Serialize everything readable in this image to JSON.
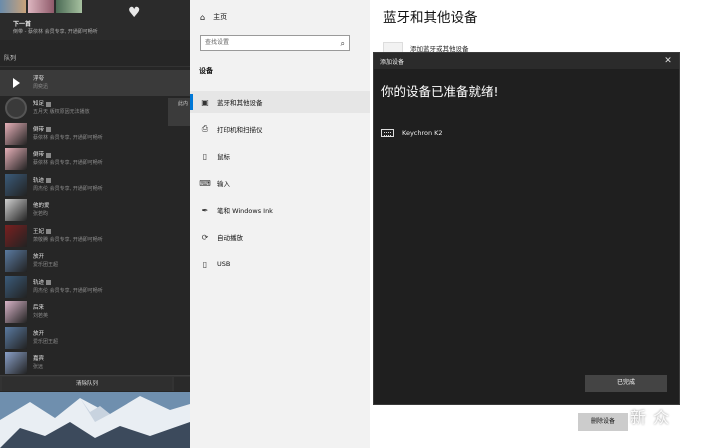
{
  "player": {
    "next_label": "下一首",
    "next_sub": "倒带 - 蔡依林  会员专享, 开通即可畅听",
    "queue_title": "队列",
    "clear_label": "清除队列",
    "popup_peek": "此内",
    "queue": [
      {
        "title": "浮夸",
        "sub": "周奕迅",
        "active": true,
        "thumb": "play",
        "tag": false,
        "thumb_color": "#444"
      },
      {
        "title": "知足",
        "sub": "五月天  版权原因无法播放",
        "active": false,
        "thumb": "disc",
        "tag": true,
        "thumb_color": "#3a3a3a"
      },
      {
        "title": "倒带",
        "sub": "蔡依林  会员专享, 开通即可畅听",
        "active": false,
        "thumb": "img",
        "tag": true,
        "thumb_color": "#e6b0b8"
      },
      {
        "title": "倒带",
        "sub": "蔡依林  会员专享, 开通即可畅听",
        "active": false,
        "thumb": "img",
        "tag": true,
        "thumb_color": "#e6b0b8"
      },
      {
        "title": "轨迹",
        "sub": "周杰伦  会员专享, 开通即可畅听",
        "active": false,
        "thumb": "img",
        "tag": true,
        "thumb_color": "#3b5b7a"
      },
      {
        "title": "他的爱",
        "sub": "张若昀",
        "active": false,
        "thumb": "img",
        "tag": false,
        "thumb_color": "#cfcfcf"
      },
      {
        "title": "王妃",
        "sub": "萧敬腾  会员专享, 开通即可畅听",
        "active": false,
        "thumb": "img",
        "tag": true,
        "thumb_color": "#7a2020"
      },
      {
        "title": "放开",
        "sub": "爱乐团王超",
        "active": false,
        "thumb": "img",
        "tag": false,
        "thumb_color": "#5a7aa0"
      },
      {
        "title": "轨迹",
        "sub": "周杰伦  会员专享, 开通即可畅听",
        "active": false,
        "thumb": "img",
        "tag": true,
        "thumb_color": "#3b5b7a"
      },
      {
        "title": "后来",
        "sub": "刘若英",
        "active": false,
        "thumb": "img",
        "tag": false,
        "thumb_color": "#d8b4c8"
      },
      {
        "title": "放开",
        "sub": "爱乐团王超",
        "active": false,
        "thumb": "img",
        "tag": false,
        "thumb_color": "#5a7aa0"
      },
      {
        "title": "嘉宾",
        "sub": "张远",
        "active": false,
        "thumb": "img",
        "tag": false,
        "thumb_color": "#8aa0c8"
      }
    ]
  },
  "settings": {
    "home_label": "主页",
    "search_placeholder": "查找设置",
    "group_title": "设备",
    "nav": [
      {
        "label": "蓝牙和其他设备",
        "icon": "bluetooth-icon",
        "glyph": "▣",
        "selected": true
      },
      {
        "label": "打印机和扫描仪",
        "icon": "printer-icon",
        "glyph": "⎙",
        "selected": false
      },
      {
        "label": "鼠标",
        "icon": "mouse-icon",
        "glyph": "▯",
        "selected": false
      },
      {
        "label": "输入",
        "icon": "keyboard-icon",
        "glyph": "⌨",
        "selected": false
      },
      {
        "label": "笔和 Windows Ink",
        "icon": "pen-icon",
        "glyph": "✒",
        "selected": false
      },
      {
        "label": "自动播放",
        "icon": "autoplay-icon",
        "glyph": "⟳",
        "selected": false
      },
      {
        "label": "USB",
        "icon": "usb-icon",
        "glyph": "▯",
        "selected": false
      }
    ],
    "content_title": "蓝牙和其他设备",
    "add_device_text": "添加蓝牙或其他设备",
    "remove_device_label": "删除设备"
  },
  "dialog": {
    "title": "添加设备",
    "heading": "你的设备已准备就绪!",
    "device_name": "Keychron K2",
    "done_label": "已完成"
  },
  "watermark": {
    "text": "新 众"
  },
  "colors": {
    "accent": "#0078d7",
    "dialog_bg": "#1f1f1f",
    "player_bg": "#262626"
  }
}
